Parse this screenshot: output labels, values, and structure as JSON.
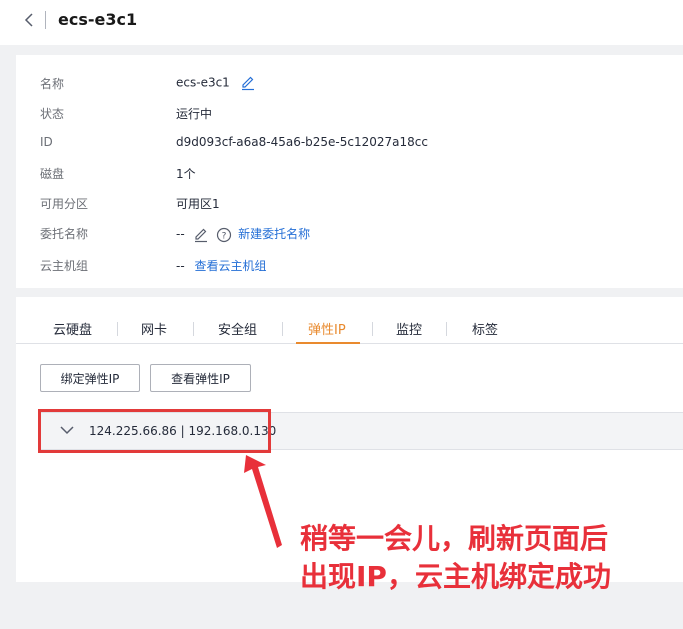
{
  "header": {
    "title": "ecs-e3c1"
  },
  "info": {
    "rows": [
      {
        "label": "名称",
        "value": "ecs-e3c1"
      },
      {
        "label": "状态",
        "value": "运行中"
      },
      {
        "label": "ID",
        "value": "d9d093cf-a6a8-45a6-b25e-5c12027a18cc"
      },
      {
        "label": "磁盘",
        "value": "1个"
      },
      {
        "label": "可用分区",
        "value": "可用区1"
      },
      {
        "label": "委托名称",
        "value": "--",
        "link": "新建委托名称"
      },
      {
        "label": "云主机组",
        "value": "--",
        "link": "查看云主机组"
      }
    ]
  },
  "tabs": [
    {
      "label": "云硬盘",
      "active": false
    },
    {
      "label": "网卡",
      "active": false
    },
    {
      "label": "安全组",
      "active": false
    },
    {
      "label": "弹性IP",
      "active": true
    },
    {
      "label": "监控",
      "active": false
    },
    {
      "label": "标签",
      "active": false
    }
  ],
  "buttons": {
    "bind": "绑定弹性IP",
    "view": "查看弹性IP"
  },
  "eip": {
    "ip_text": "124.225.66.86 | 192.168.0.130"
  },
  "annotation": {
    "line1": "稍等一会儿，刷新页面后",
    "line2": "出现IP，云主机绑定成功"
  },
  "colors": {
    "accent": "#e98a2e",
    "link": "#256fd6",
    "annotation": "#e8303a"
  },
  "icons": [
    "back-icon",
    "edit-icon",
    "help-icon",
    "chevron-down-icon"
  ]
}
